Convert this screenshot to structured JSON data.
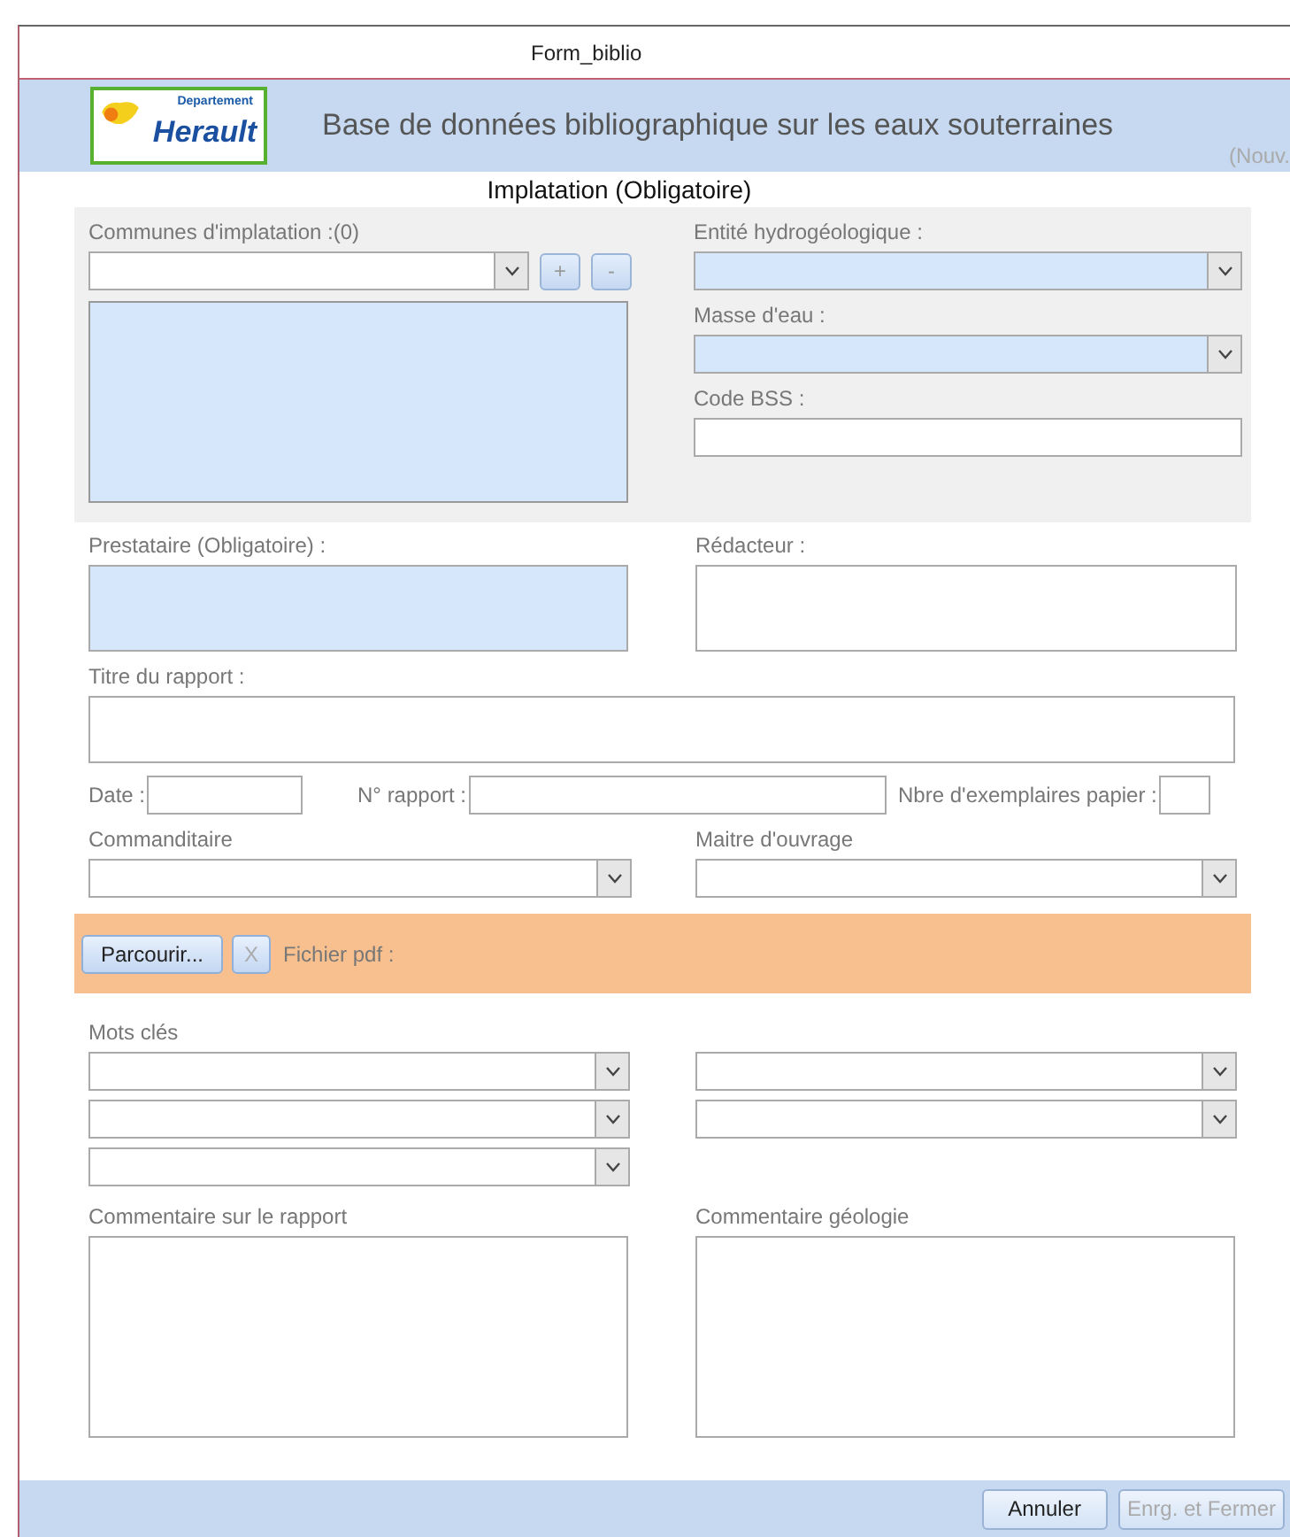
{
  "window": {
    "title": "Form_biblio"
  },
  "header": {
    "logo": {
      "line_1": "Departement",
      "line_2": "Herault"
    },
    "title": "Base de données bibliographique sur les eaux souterraines",
    "status": "(Nouv."
  },
  "section_title": "Implatation (Obligatoire)",
  "communes": {
    "label": "Communes d'implatation :(0)",
    "combo_highlighted": false,
    "list_highlighted": true,
    "buttons": [
      {
        "label": "+",
        "disabled": true
      },
      {
        "label": "-",
        "disabled": true
      }
    ]
  },
  "right_fields": [
    {
      "label": "Entité hydrogéologique :",
      "kind": "combo",
      "highlighted": true
    },
    {
      "label": "Masse d'eau :",
      "kind": "combo",
      "highlighted": true
    },
    {
      "label": "Code BSS :",
      "kind": "text",
      "highlighted": false
    }
  ],
  "prestataire": {
    "label": "Prestataire (Obligatoire) :",
    "highlighted": true
  },
  "redacteur": {
    "label": "Rédacteur :",
    "highlighted": false
  },
  "titre": {
    "label": "Titre du rapport :"
  },
  "inline_fields": [
    {
      "label": "Date :"
    },
    {
      "label": "N° rapport :"
    },
    {
      "label": "Nbre d'exemplaires papier :"
    }
  ],
  "commanditaire": {
    "label": "Commanditaire"
  },
  "maitre_ouvrage": {
    "label": "Maitre d'ouvrage"
  },
  "file_bar": {
    "buttons": [
      {
        "label": "Parcourir...",
        "disabled": false
      },
      {
        "label": "X",
        "disabled": true
      }
    ],
    "label": "Fichier pdf :"
  },
  "mots_cles": {
    "label": "Mots clés",
    "columns": [
      [
        {
          "kind": "combo"
        },
        {
          "kind": "combo"
        },
        {
          "kind": "combo"
        }
      ],
      [
        {
          "kind": "combo"
        },
        {
          "kind": "combo"
        }
      ]
    ]
  },
  "comments": [
    {
      "label": "Commentaire sur le rapport"
    },
    {
      "label": "Commentaire géologie"
    }
  ],
  "footer": {
    "buttons": [
      {
        "label": "Annuler",
        "disabled": false
      },
      {
        "label": "Enrg. et Fermer",
        "disabled": true
      }
    ]
  }
}
